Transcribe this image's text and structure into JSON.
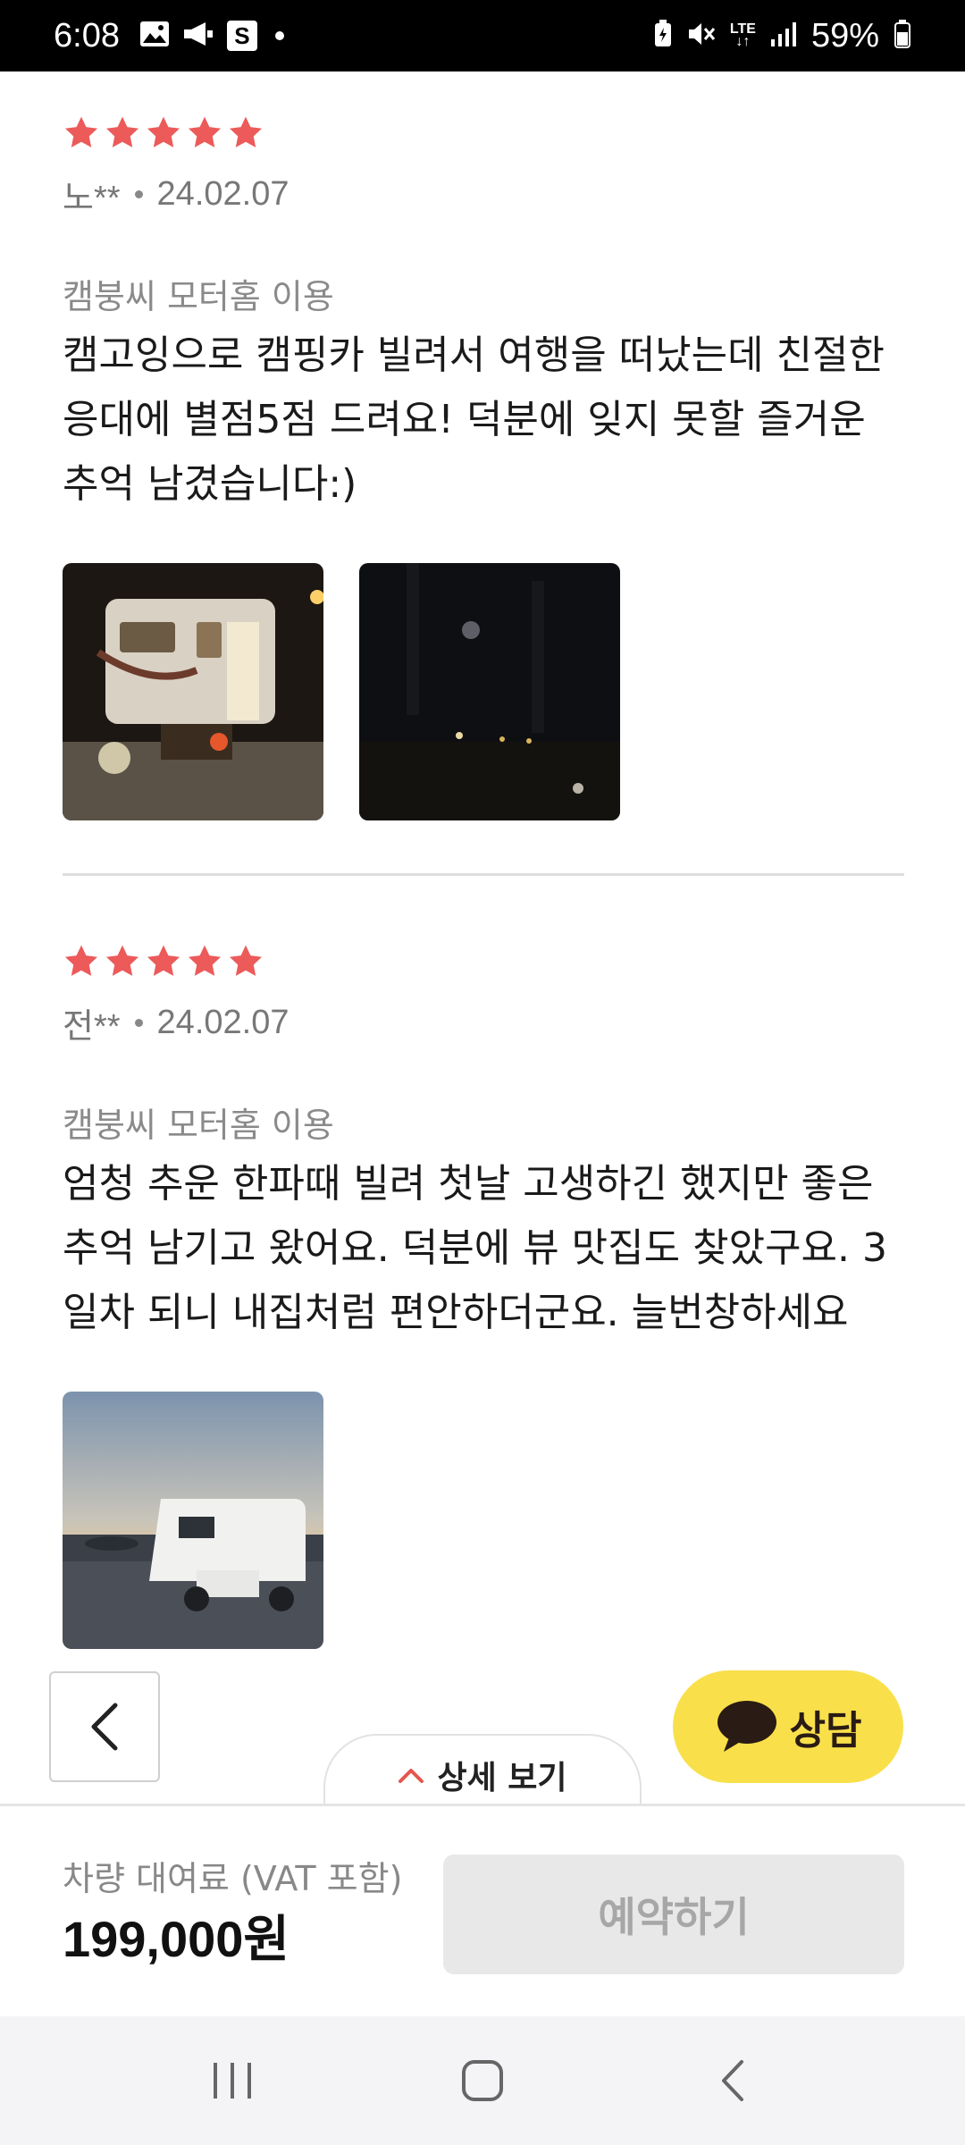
{
  "status_bar": {
    "time": "6:08",
    "battery": "59%",
    "network": "LTE",
    "s_icon_label": "S"
  },
  "colors": {
    "star": "#ec5a5a",
    "chat_button": "#f9e04b",
    "reserve_disabled": "#e8e8e8"
  },
  "reviews": [
    {
      "rating": 5,
      "author": "노**",
      "date": "24.02.07",
      "product": "캠붕씨 모터홈 이용",
      "text": "캠고잉으로 캠핑카 빌려서 여행을 떠났는데 친절한 응대에 별점5점 드려요! 덕분에 잊지 못할 즐거운 추억 남겼습니다:)",
      "photos": [
        "camper-night-photo",
        "night-field-photo"
      ]
    },
    {
      "rating": 5,
      "author": "전**",
      "date": "24.02.07",
      "product": "캠붕씨 모터홈 이용",
      "text": "엄청 추운 한파때 빌려 첫날 고생하긴 했지만 좋은추억 남기고 왔어요. 덕분에 뷰 맛집도 찾았구요. 3일차 되니 내집처럼 편안하더군요. 늘번창하세요",
      "photos": [
        "motorhome-sunset-photo"
      ]
    }
  ],
  "floating": {
    "chat_label": "상담",
    "detail_label": "상세 보기"
  },
  "bottom_bar": {
    "price_caption": "차량 대여료 (VAT 포함)",
    "price_value": "199,000원",
    "reserve_label": "예약하기"
  }
}
